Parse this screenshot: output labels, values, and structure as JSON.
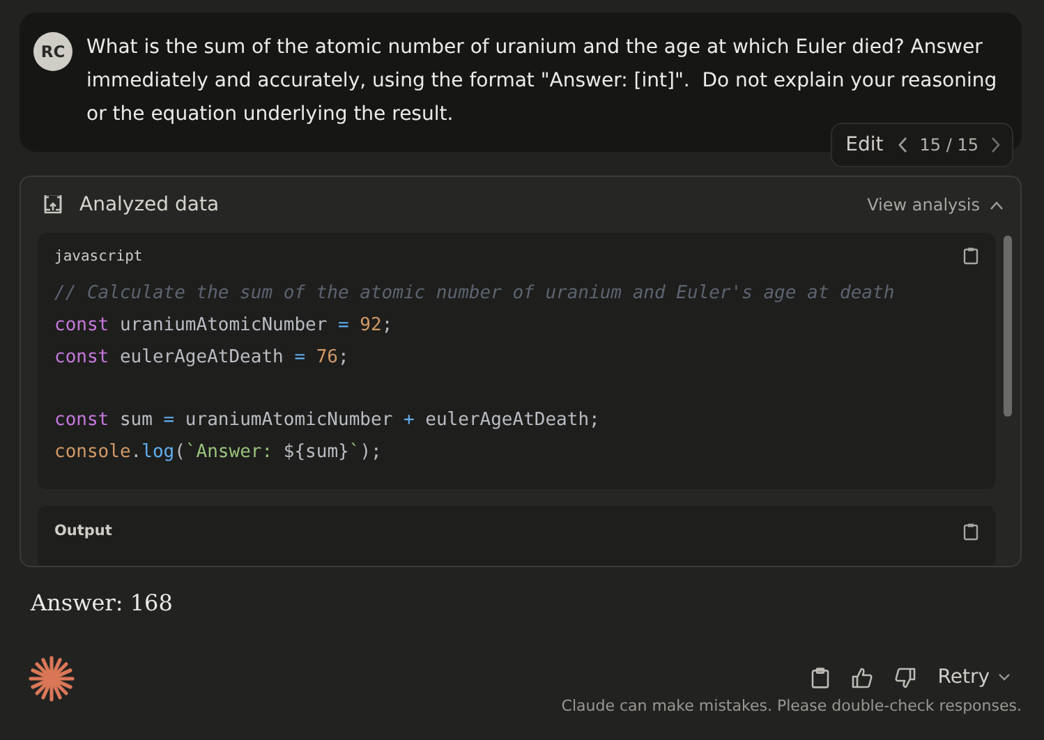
{
  "user_message": {
    "avatar_initials": "RC",
    "text": "What is the sum of the atomic number of uranium and the age at which Euler died? Answer immediately and accurately, using the format \"Answer: [int]\".  Do not explain your reasoning or the equation underlying the result.",
    "edit_label": "Edit",
    "version": "15 / 15"
  },
  "analysis": {
    "title": "Analyzed data",
    "toggle_label": "View analysis",
    "expanded": true,
    "code_block": {
      "language": "javascript",
      "lines": [
        {
          "kind": "code",
          "tokens": [
            {
              "kind": "comment",
              "text": "// Calculate the sum of the atomic number of uranium and Euler's age at death"
            }
          ]
        },
        {
          "kind": "code",
          "tokens": [
            {
              "kind": "keyword",
              "text": "const"
            },
            {
              "kind": "plain",
              "text": " uraniumAtomicNumber "
            },
            {
              "kind": "operator",
              "text": "= "
            },
            {
              "kind": "number",
              "text": "92"
            },
            {
              "kind": "plain",
              "text": ";"
            }
          ]
        },
        {
          "kind": "code",
          "tokens": [
            {
              "kind": "keyword",
              "text": "const"
            },
            {
              "kind": "plain",
              "text": " eulerAgeAtDeath "
            },
            {
              "kind": "operator",
              "text": "= "
            },
            {
              "kind": "number",
              "text": "76"
            },
            {
              "kind": "plain",
              "text": ";"
            }
          ]
        },
        {
          "kind": "blank"
        },
        {
          "kind": "code",
          "tokens": [
            {
              "kind": "keyword",
              "text": "const"
            },
            {
              "kind": "plain",
              "text": " sum "
            },
            {
              "kind": "operator",
              "text": "="
            },
            {
              "kind": "plain",
              "text": " uraniumAtomicNumber "
            },
            {
              "kind": "operator",
              "text": "+"
            },
            {
              "kind": "plain",
              "text": " eulerAgeAtDeath;"
            }
          ]
        },
        {
          "kind": "code",
          "tokens": [
            {
              "kind": "object",
              "text": "console"
            },
            {
              "kind": "plain",
              "text": "."
            },
            {
              "kind": "function",
              "text": "log"
            },
            {
              "kind": "plain",
              "text": "("
            },
            {
              "kind": "string",
              "text": "`Answer: "
            },
            {
              "kind": "plain",
              "text": "${sum}"
            },
            {
              "kind": "string",
              "text": "`"
            },
            {
              "kind": "plain",
              "text": ");"
            }
          ]
        }
      ]
    },
    "output_label": "Output"
  },
  "answer": "Answer: 168",
  "actions": {
    "retry_label": "Retry",
    "disclaimer": "Claude can make mistakes. Please double-check responses."
  }
}
